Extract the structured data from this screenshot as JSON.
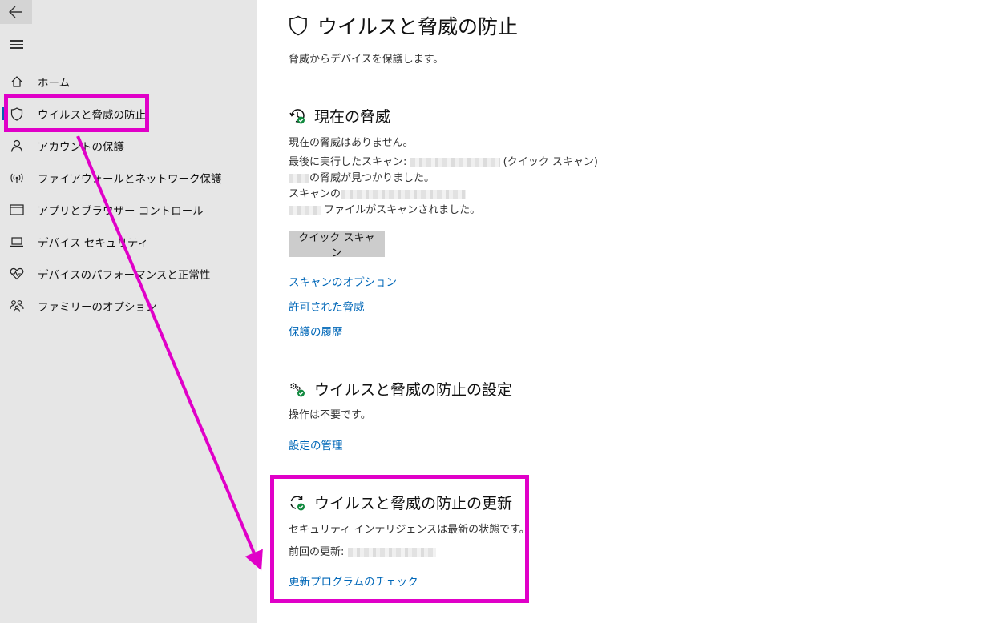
{
  "sidebar": {
    "back_icon": "arrow-left-icon",
    "menu_icon": "hamburger-icon",
    "items": [
      {
        "label": "ホーム",
        "icon": "home-icon"
      },
      {
        "label": "ウイルスと脅威の防止",
        "icon": "shield-icon"
      },
      {
        "label": "アカウントの保護",
        "icon": "person-icon"
      },
      {
        "label": "ファイアウォールとネットワーク保護",
        "icon": "wireless-icon"
      },
      {
        "label": "アプリとブラウザー コントロール",
        "icon": "browser-window-icon"
      },
      {
        "label": "デバイス セキュリティ",
        "icon": "laptop-icon"
      },
      {
        "label": "デバイスのパフォーマンスと正常性",
        "icon": "heart-icon"
      },
      {
        "label": "ファミリーのオプション",
        "icon": "family-icon"
      }
    ],
    "active_index": 1
  },
  "main": {
    "title": "ウイルスと脅威の防止",
    "subtitle": "脅威からデバイスを保護します。",
    "current_threats": {
      "heading": "現在の脅威",
      "line1": "現在の脅威はありません。",
      "line2_prefix": "最後に実行したスキャン: ",
      "line2_suffix": " (クイック スキャン)",
      "line3_suffix": "の脅威が見つかりました。",
      "line4_prefix": "スキャンの",
      "line5_suffix": " ファイルがスキャンされました。",
      "button": "クイック スキャン",
      "links": [
        "スキャンのオプション",
        "許可された脅威",
        "保護の履歴"
      ]
    },
    "settings": {
      "heading": "ウイルスと脅威の防止の設定",
      "status": "操作は不要です。",
      "link": "設定の管理"
    },
    "updates": {
      "heading": "ウイルスと脅威の防止の更新",
      "status": "セキュリティ インテリジェンスは最新の状態です。",
      "last_update_label": "前回の更新: ",
      "link": "更新プログラムのチェック"
    }
  },
  "colors": {
    "highlight": "#e000c8",
    "link": "#0067b8",
    "sidebar_bg": "#e6e6e6",
    "status_ok": "#10893e"
  }
}
